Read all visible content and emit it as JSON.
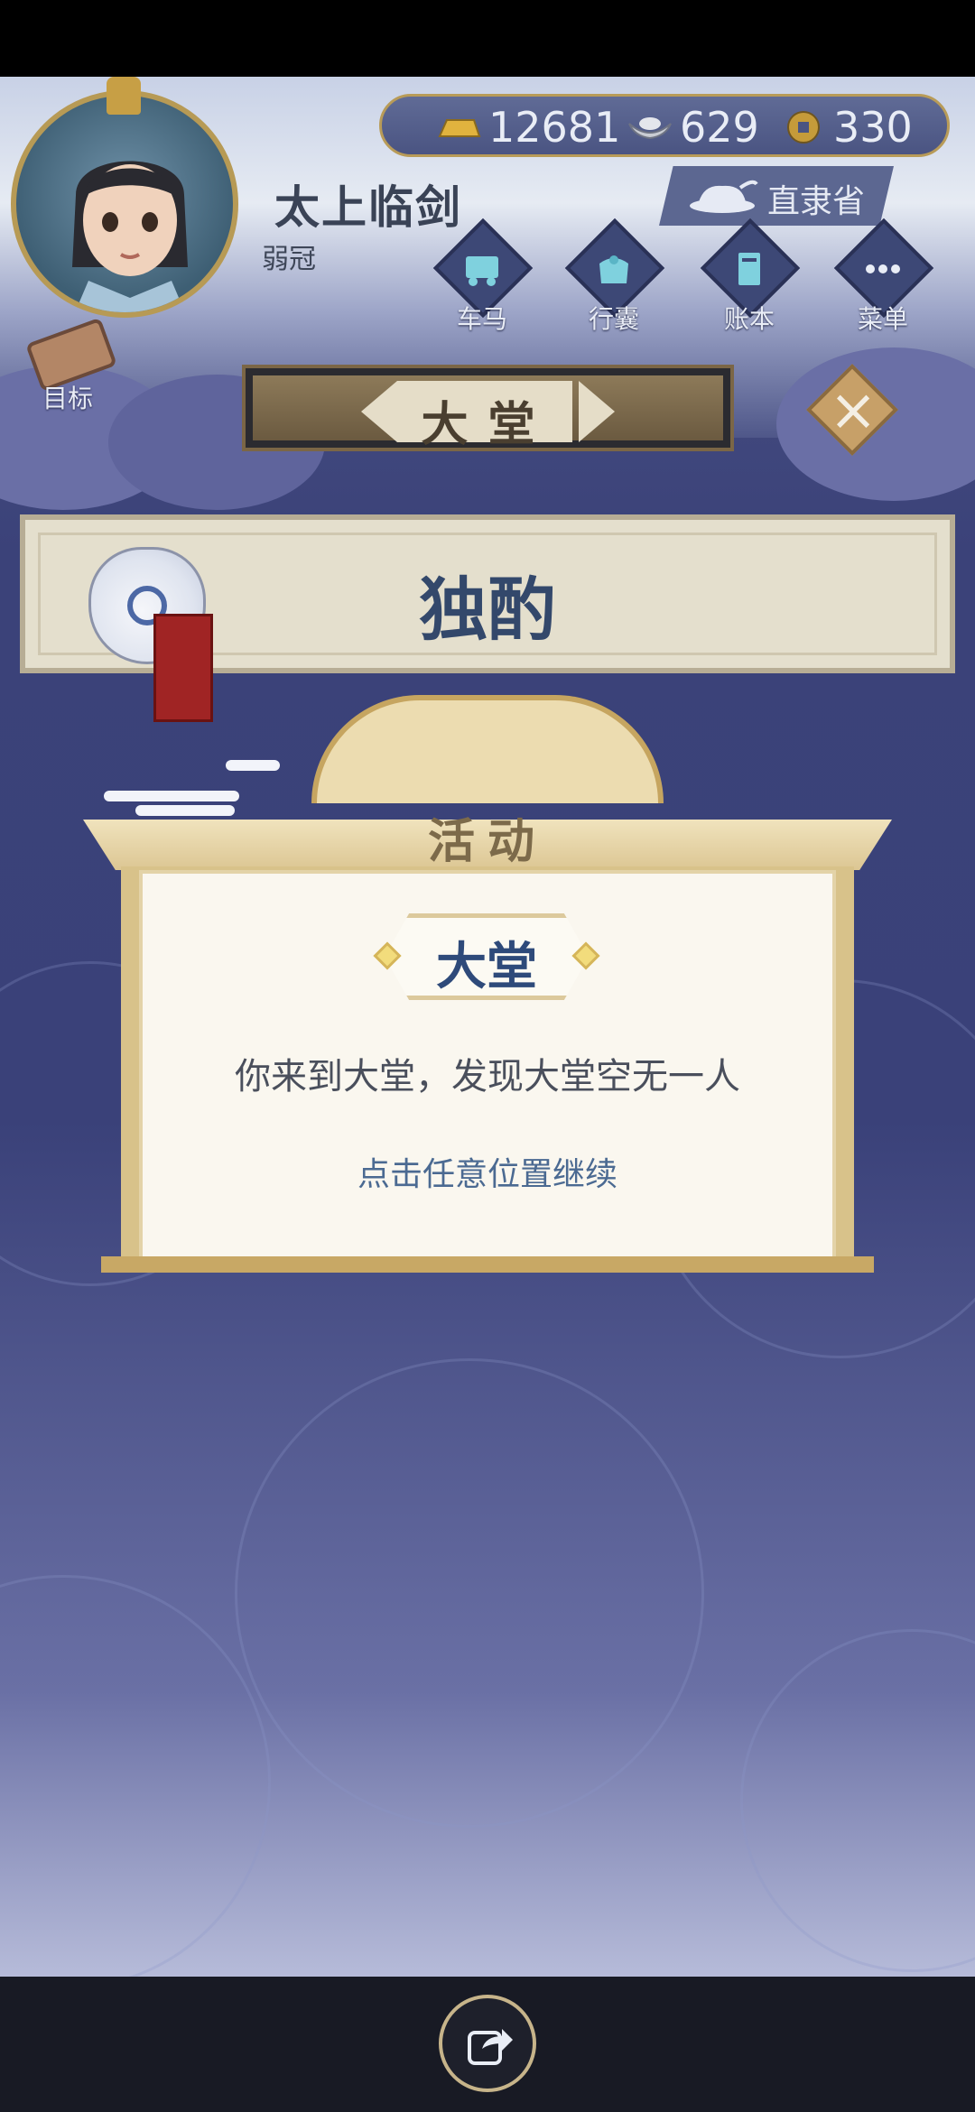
{
  "player": {
    "name": "太上临剑",
    "title": "弱冠",
    "avatar_icon": "character-portrait-icon"
  },
  "currency": {
    "gold": "12681",
    "silver": "629",
    "coin": "330",
    "icons": [
      "gold-bar-icon",
      "silver-ingot-icon",
      "copper-coin-icon"
    ]
  },
  "region": {
    "label": "直隶省",
    "icon": "tea-pot-icon"
  },
  "nav": {
    "items": [
      {
        "label": "车马",
        "icon": "carriage-icon"
      },
      {
        "label": "行囊",
        "icon": "bag-icon"
      },
      {
        "label": "账本",
        "icon": "ledger-icon"
      },
      {
        "label": "菜单",
        "icon": "more-dots-icon"
      }
    ],
    "target_label": "目标"
  },
  "location": {
    "label": "大堂"
  },
  "event": {
    "name": "独酌"
  },
  "dialog": {
    "title": "活动",
    "tag": "大堂",
    "message": "你来到大堂，发现大堂空无一人",
    "hint": "点击任意位置继续"
  },
  "colors": {
    "background": "#3a4179",
    "accent_gold": "#c6a560",
    "dialog_bg": "#faf7ef",
    "title_blue": "#2e4a7a"
  }
}
